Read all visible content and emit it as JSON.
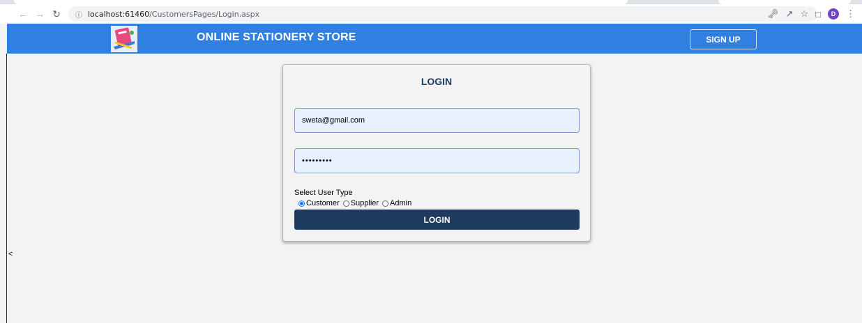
{
  "browser": {
    "url_host": "localhost:61460",
    "url_path": "/CustomersPages/Login.aspx",
    "profile_initial": "D",
    "icons": [
      "back-icon",
      "forward-icon",
      "reload-icon",
      "info-icon",
      "key-icon",
      "share-icon",
      "star-icon",
      "sidepanel-icon",
      "menu-icon"
    ]
  },
  "header": {
    "title": "ONLINE STATIONERY STORE",
    "signup_label": "SIGN UP",
    "background": "#2f80e0"
  },
  "login": {
    "heading": "LOGIN",
    "email_value": "sweta@gmail.com",
    "password_value": "•••••••••",
    "user_type_label": "Select User Type",
    "user_types": [
      {
        "label": "Customer",
        "checked": true
      },
      {
        "label": "Supplier",
        "checked": false
      },
      {
        "label": "Admin",
        "checked": false
      }
    ],
    "button_label": "LOGIN",
    "button_color": "#1e3a5f"
  },
  "stray_text": "<"
}
